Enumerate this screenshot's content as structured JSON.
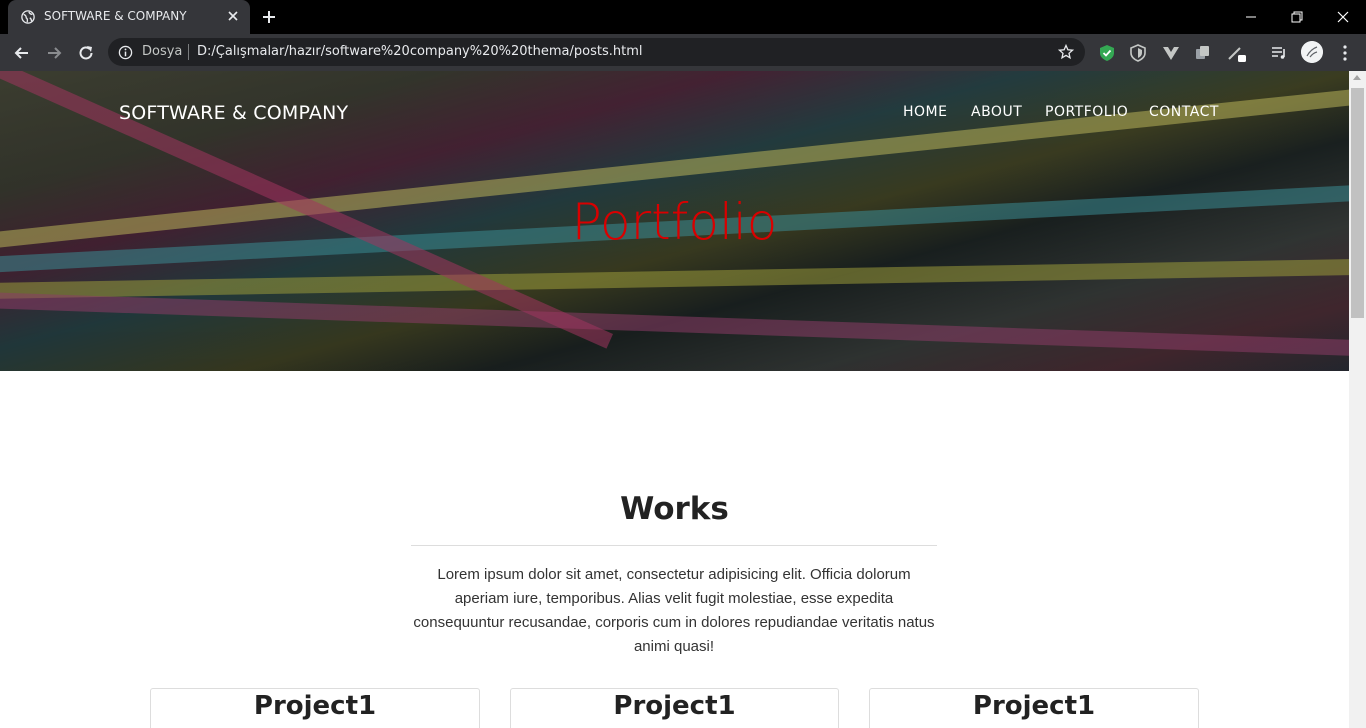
{
  "browser": {
    "tab_title": "SOFTWARE & COMPANY",
    "omnibox": {
      "scheme_label": "Dosya",
      "url": "D:/Çalışmalar/hazır/software%20company%20%20thema/posts.html"
    },
    "colors": {
      "frame": "#000000",
      "toolbar": "#35363a",
      "omnibox": "#202124",
      "shield_ext": "#34a853"
    },
    "icons": [
      "globe-icon",
      "close-icon",
      "plus-icon",
      "minimize-icon",
      "restore-icon",
      "back-icon",
      "forward-icon",
      "reload-icon",
      "info-icon",
      "star-icon",
      "shield-icon",
      "menu-icon"
    ]
  },
  "site": {
    "brand": "SOFTWARE & COMPANY",
    "nav": [
      {
        "label": "HOME"
      },
      {
        "label": "ABOUT"
      },
      {
        "label": "PORTFOLIO"
      },
      {
        "label": "CONTACT"
      }
    ],
    "hero_title": "Portfolio",
    "hero_title_color": "#d90000"
  },
  "works": {
    "heading": "Works",
    "text": "Lorem ipsum dolor sit amet, consectetur adipisicing elit. Officia dolorum aperiam iure, temporibus. Alias velit fugit molestiae, esse expedita consequuntur recusandae, corporis cum in dolores repudiandae veritatis natus animi quasi!",
    "cards": [
      {
        "title": "Project1"
      },
      {
        "title": "Project1"
      },
      {
        "title": "Project1"
      }
    ]
  }
}
